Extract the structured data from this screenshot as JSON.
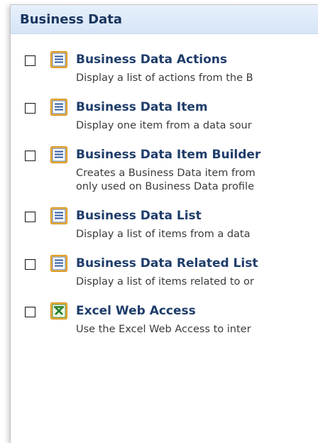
{
  "header": {
    "title": "Business Data"
  },
  "items": [
    {
      "title": "Business Data Actions",
      "desc": [
        "Display a list of actions from the B"
      ],
      "icon": "webpart-icon"
    },
    {
      "title": "Business Data Item",
      "desc": [
        "Display one item from a data sour"
      ],
      "icon": "webpart-icon"
    },
    {
      "title": "Business Data Item Builder",
      "desc": [
        "Creates a Business Data item from",
        "only used on Business Data profile"
      ],
      "icon": "webpart-icon"
    },
    {
      "title": "Business Data List",
      "desc": [
        "Display a list of items from a data"
      ],
      "icon": "webpart-icon"
    },
    {
      "title": "Business Data Related List",
      "desc": [
        "Display a list of items related to or"
      ],
      "icon": "webpart-icon"
    },
    {
      "title": "Excel Web Access",
      "desc": [
        "Use the Excel Web Access to inter"
      ],
      "icon": "excel-icon"
    }
  ]
}
